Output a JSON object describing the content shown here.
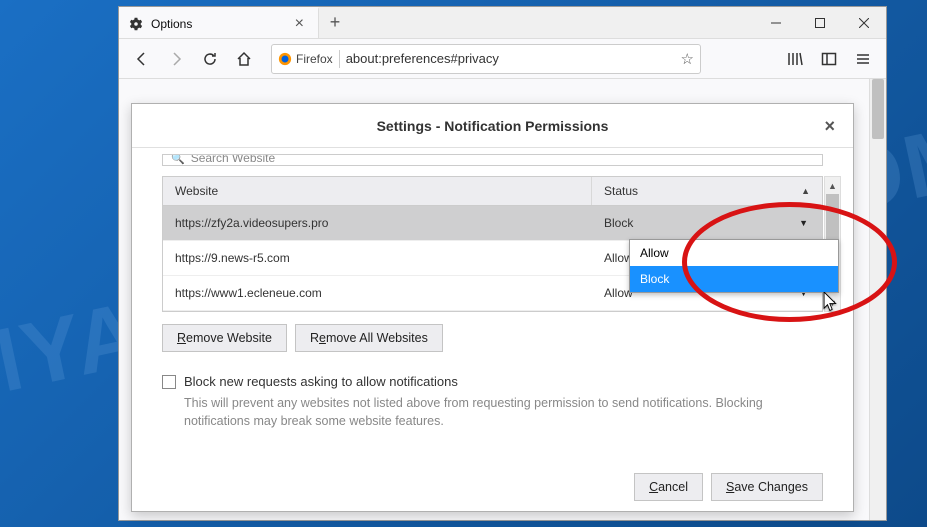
{
  "titlebar": {
    "tab_title": "Options",
    "tab_icon_name": "gear-icon"
  },
  "toolbar": {
    "identity_label": "Firefox",
    "url": "about:preferences#privacy"
  },
  "dialog": {
    "title": "Settings - Notification Permissions",
    "search_placeholder": "Search Website",
    "columns": {
      "website": "Website",
      "status": "Status"
    },
    "rows": [
      {
        "website": "https://zfy2a.videosupers.pro",
        "status": "Block",
        "selected": true,
        "dropdown_open": true
      },
      {
        "website": "https://9.news-r5.com",
        "status": "Allow",
        "selected": false
      },
      {
        "website": "https://www1.ecleneue.com",
        "status": "Allow",
        "selected": false
      }
    ],
    "dropdown_options": [
      {
        "label": "Allow",
        "hovered": false
      },
      {
        "label": "Block",
        "hovered": true
      }
    ],
    "remove_website_label": "Remove Website",
    "remove_all_label": "Remove All Websites",
    "checkbox_label": "Block new requests asking to allow notifications",
    "checkbox_checked": false,
    "help_text": "This will prevent any websites not listed above from requesting permission to send notifications. Blocking notifications may break some website features.",
    "cancel_label": "Cancel",
    "save_label": "Save Changes"
  },
  "colors": {
    "highlight_red": "#d81314",
    "selection_blue": "#1991ff"
  }
}
